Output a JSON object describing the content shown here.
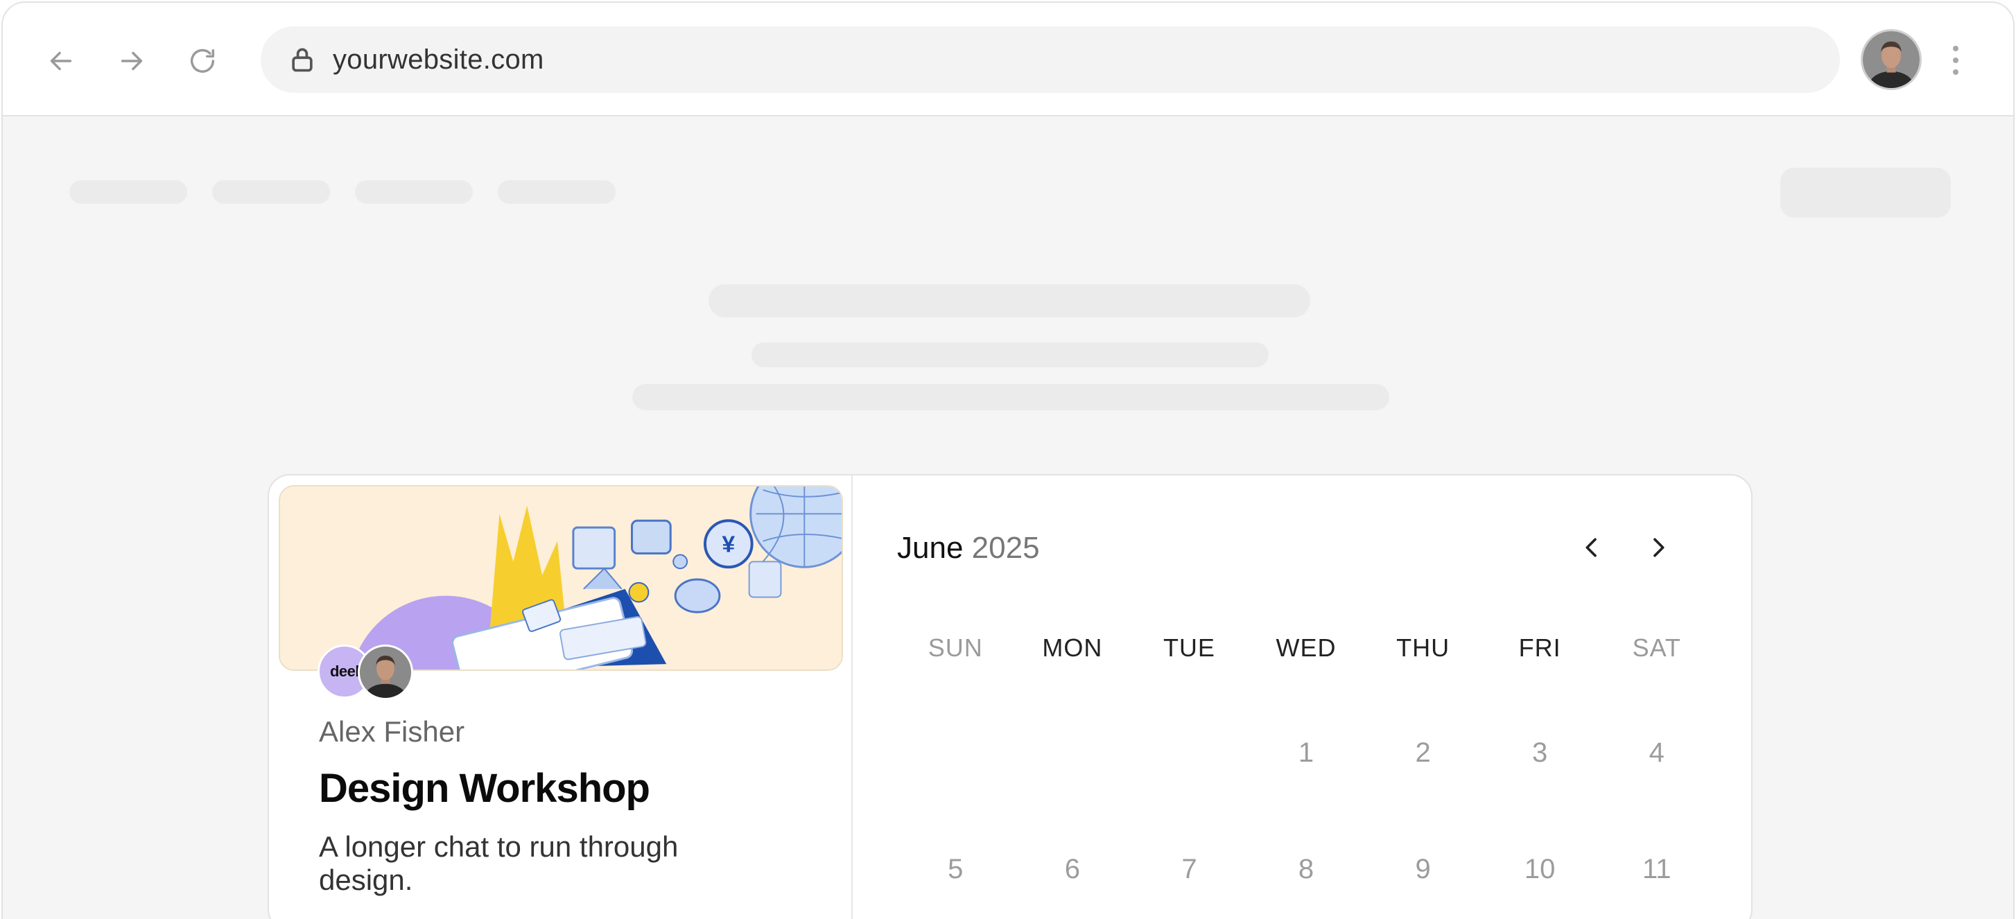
{
  "browser": {
    "url": "yourwebsite.com",
    "icons": [
      "back-arrow-icon",
      "forward-arrow-icon",
      "reload-icon",
      "lock-icon",
      "kebab-menu-icon"
    ]
  },
  "event": {
    "host_logo_text": "deel",
    "host_name": "Alex Fisher",
    "title": "Design Workshop",
    "description": "A longer chat to run through design."
  },
  "calendar": {
    "month": "June",
    "year": "2025",
    "weekdays": [
      "SUN",
      "MON",
      "TUE",
      "WED",
      "THU",
      "FRI",
      "SAT"
    ],
    "weeks": [
      [
        "",
        "",
        "",
        "1",
        "2",
        "3",
        "4"
      ],
      [
        "5",
        "6",
        "7",
        "8",
        "9",
        "10",
        "11"
      ]
    ]
  },
  "colors": {
    "page_background": "#f5f5f5",
    "skeleton": "#ebebeb",
    "banner_background": "#fdefd9",
    "deel_badge": "#c6b4f3"
  }
}
